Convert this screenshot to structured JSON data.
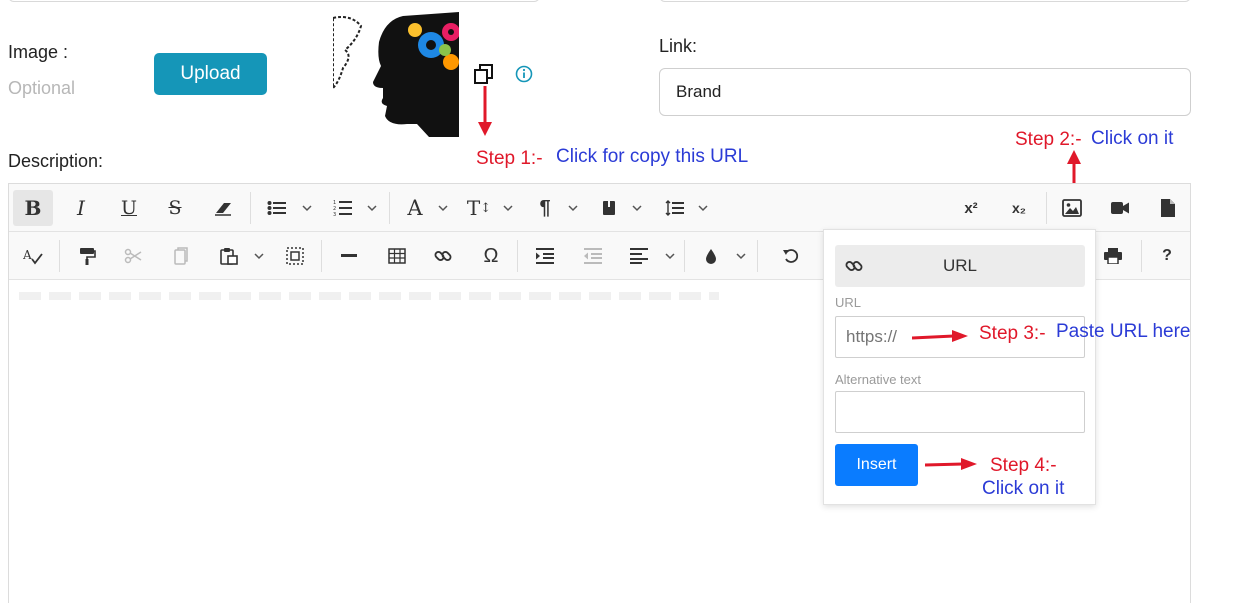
{
  "form": {
    "image_label": "Image :",
    "image_hint": "Optional",
    "upload_label": "Upload",
    "link_label": "Link:",
    "link_value": "Brand",
    "description_label": "Description:"
  },
  "steps": {
    "step1_prefix": "Step 1:-",
    "step1_text": "Click for copy this URL",
    "step2_prefix": "Step 2:-",
    "step2_text": "Click on it",
    "step3_prefix": "Step 3:-",
    "step3_text": "Paste URL here",
    "step4_prefix": "Step 4:-",
    "step4_text": "Click on it"
  },
  "toolbar": {
    "bold": "B",
    "italic": "I",
    "underline": "U",
    "strike": "S",
    "font_color": "A",
    "font_size": "T",
    "paragraph": "¶",
    "superscript": "x²",
    "subscript": "x₂",
    "special_char": "Ω",
    "help": "?"
  },
  "image_popup": {
    "tab_label": "URL",
    "url_label": "URL",
    "url_placeholder": "https://",
    "alt_label": "Alternative text",
    "alt_value": "",
    "insert_label": "Insert"
  },
  "colors": {
    "upload_button": "#1596b8",
    "insert_button": "#0a7cff",
    "annotation_red": "#e0182a",
    "annotation_blue": "#2b3bd6"
  }
}
